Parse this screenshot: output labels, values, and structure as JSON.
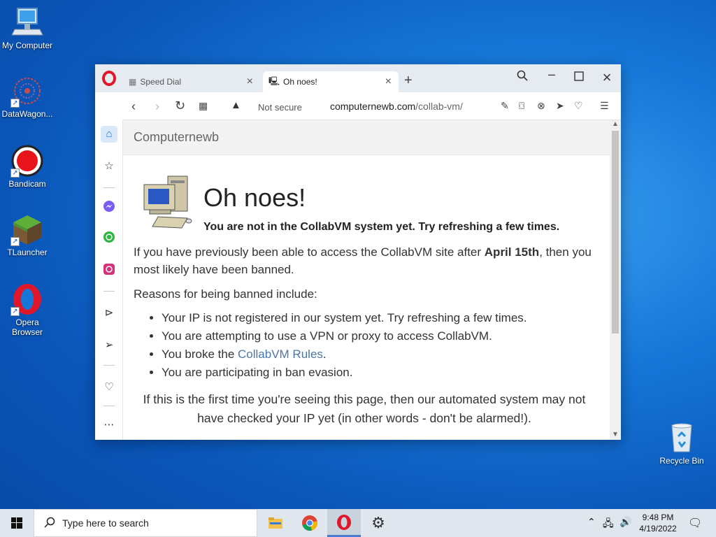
{
  "desktop": {
    "icons": [
      {
        "label": "My Computer"
      },
      {
        "label": "DataWagon..."
      },
      {
        "label": "Bandicam"
      },
      {
        "label": "TLauncher"
      },
      {
        "label": "Opera Browser"
      },
      {
        "label": "Recycle Bin"
      }
    ]
  },
  "browser": {
    "tabs": [
      {
        "label": "Speed Dial"
      },
      {
        "label": "Oh noes!"
      }
    ],
    "new_tab": "+",
    "security_label": "Not secure",
    "url_host": "computernewb.com",
    "url_path": "/collab-vm/"
  },
  "page": {
    "site_name": "Computernewb",
    "title": "Oh noes!",
    "subtitle": "You are not in the CollabVM system yet. Try refreshing a few times.",
    "para1_before": "If you have previously been able to access the CollabVM site after ",
    "para1_bold": "April 15th",
    "para1_after": ", then you most likely have been banned.",
    "reasons_intro": "Reasons for being banned include:",
    "reasons": [
      "Your IP is not registered in our system yet. Try refreshing a few times.",
      "You are attempting to use a VPN or proxy to access CollabVM.",
      "You are participating in ban evasion."
    ],
    "reason3_before": "You broke the ",
    "reason3_link": "CollabVM Rules",
    "reason3_after": ".",
    "para2": "If this is the first time you're seeing this page, then our automated system may not have checked your IP yet (in other words - don't be alarmed!)."
  },
  "taskbar": {
    "search_placeholder": "Type here to search",
    "time": "9:48 PM",
    "date": "4/19/2022"
  },
  "colors": {
    "opera_red": "#e0172b",
    "link": "#4a78a5",
    "desktop_blue": "#1677d8"
  }
}
